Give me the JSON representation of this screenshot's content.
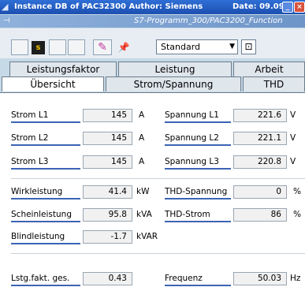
{
  "window": {
    "title": "Instance DB of PAC32300 Author: Siemens",
    "date": "Date: 09.09.",
    "subtitle": "S7-Programm_300/PAC3200_Function",
    "minimize_glyph": "_",
    "close_glyph": "×"
  },
  "toolbar": {
    "s_button": "s",
    "select_value": "Standard",
    "icons": [
      "pencil-icon",
      "pushpin-icon",
      "settings-icon"
    ]
  },
  "tabs": {
    "row1": [
      "Leistungsfaktor",
      "Leistung",
      "Arbeit"
    ],
    "row2": [
      "Übersicht",
      "Strom/Spannung",
      "THD"
    ],
    "active": "Übersicht"
  },
  "values": {
    "strom_l1": {
      "label": "Strom L1",
      "value": "145",
      "unit": "A"
    },
    "strom_l2": {
      "label": "Strom L2",
      "value": "145",
      "unit": "A"
    },
    "strom_l3": {
      "label": "Strom L3",
      "value": "145",
      "unit": "A"
    },
    "spannung_l1": {
      "label": "Spannung L1",
      "value": "221.6",
      "unit": "V"
    },
    "spannung_l2": {
      "label": "Spannung L2",
      "value": "221.1",
      "unit": "V"
    },
    "spannung_l3": {
      "label": "Spannung L3",
      "value": "220.8",
      "unit": "V"
    },
    "wirkleistung": {
      "label": "Wirkleistung",
      "value": "41.4",
      "unit": "kW"
    },
    "scheinleistung": {
      "label": "Scheinleistung",
      "value": "95.8",
      "unit": "kVA"
    },
    "blindleistung": {
      "label": "Blindleistung",
      "value": "-1.7",
      "unit": "kVAR"
    },
    "thd_spannung": {
      "label": "THD-Spannung",
      "value": "0",
      "unit": "%"
    },
    "thd_strom": {
      "label": "THD-Strom",
      "value": "86",
      "unit": "%"
    },
    "lstg_fakt": {
      "label": "Lstg.fakt. ges.",
      "value": "0.43"
    },
    "frequenz": {
      "label": "Frequenz",
      "value": "50.03",
      "unit": "Hz"
    }
  },
  "colors": {
    "titlebar": "#2f6fd6",
    "accent_underline": "#3c64b4",
    "background": "#c6d9e6"
  }
}
